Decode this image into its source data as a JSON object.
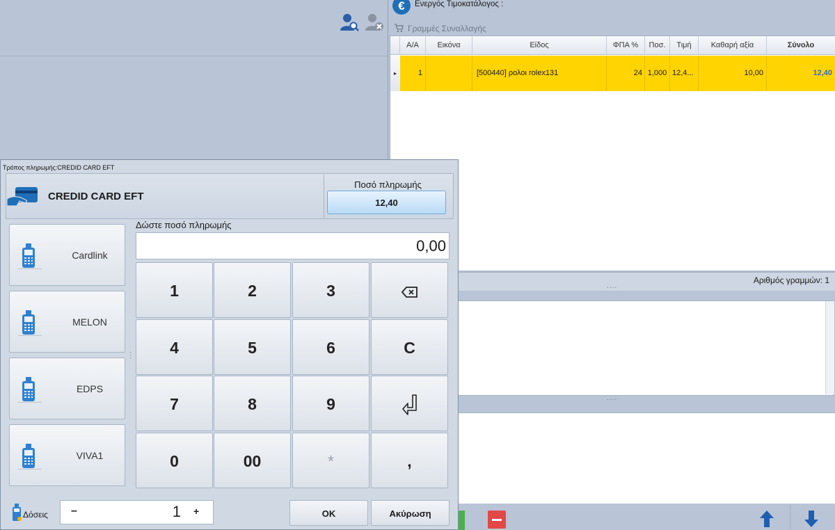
{
  "pricelist": {
    "label": "Ενεργός Τιμοκατάλογος :"
  },
  "lines": {
    "label": "Γραμμές Συναλλαγής"
  },
  "grid": {
    "columns": [
      "Α/Α",
      "Εικόνα",
      "Είδος",
      "ΦΠΑ %",
      "Ποσ.",
      "Τιμή",
      "Καθαρή αξία",
      "Σύνολο"
    ],
    "rows": [
      {
        "aa": "1",
        "image": "",
        "item": "[500440] ρολοι rolex131",
        "vat": "24",
        "qty": "1,000",
        "price": "12,4...",
        "net": "10,00",
        "total": "12,40"
      }
    ],
    "row_count_label": "Αριθμός γραμμών: 1"
  },
  "dialog": {
    "title": "Τρόπος πληρωμής:CREDID CARD EFT",
    "method": "CREDID CARD EFT",
    "amount_label": "Ποσό πληρωμής",
    "amount_value": "12,40",
    "enter_label": "Δώστε ποσό πληρωμής",
    "input_value": "0,00",
    "terminals": [
      "Cardlink",
      "MELON",
      "EDPS",
      "VIVA1"
    ],
    "keys": [
      "1",
      "2",
      "3",
      "backspace",
      "4",
      "5",
      "6",
      "C",
      "7",
      "8",
      "9",
      "enter",
      "0",
      "00",
      "*",
      ","
    ],
    "doses_label": "Δόσεις",
    "doses_minus": "–",
    "doses_value": "1",
    "doses_plus": "+",
    "ok_label": "OK",
    "cancel_label": "Ακύρωση"
  },
  "colors": {
    "selected_row": "#ffd400",
    "total_text": "#3a6bc5",
    "accent_blue": "#1f6fb8",
    "delete_red": "#e34848",
    "add_green": "#4caf50"
  }
}
